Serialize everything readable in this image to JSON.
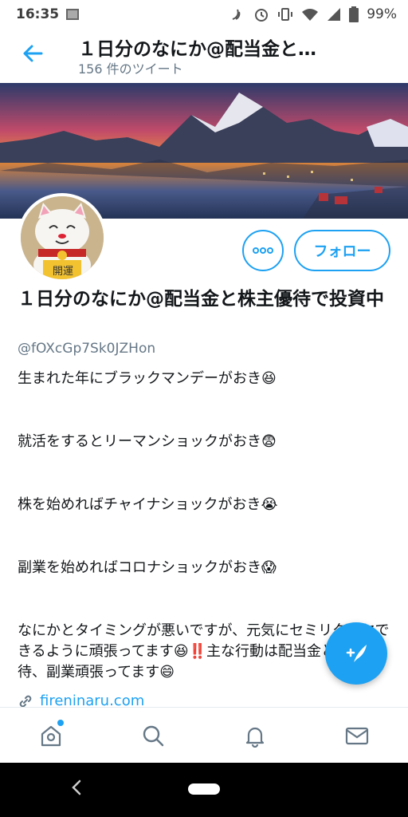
{
  "status_bar": {
    "time": "16:35",
    "battery": "99%"
  },
  "header": {
    "title": "１日分のなにか@配当金と…",
    "tweet_count": "156 件のツイート"
  },
  "profile": {
    "display_name": "１日分のなにか@配当金と株主優待で投資中",
    "handle": "@fOXcGp7Sk0JZHon",
    "more_label": "ooo",
    "follow_label": "フォロー",
    "bio": [
      "生まれた年にブラックマンデーがおき😆",
      "就活をするとリーマンショックがおき😨",
      "株を始めればチャイナショックがおき😭",
      "副業を始めればコロナショックがおき😱",
      "なにかとタイミングが悪いですが、元気にセミリタイヤできるように頑張ってます😆‼️主な行動は配当金と株主優待、副業頑張ってます😄"
    ],
    "link": "fireninaru.com"
  },
  "colors": {
    "accent": "#1da1f2",
    "text": "#14171a",
    "muted": "#657786"
  },
  "icons": [
    "back-arrow-icon",
    "home-icon",
    "search-icon",
    "bell-icon",
    "mail-icon",
    "compose-icon",
    "link-icon"
  ]
}
